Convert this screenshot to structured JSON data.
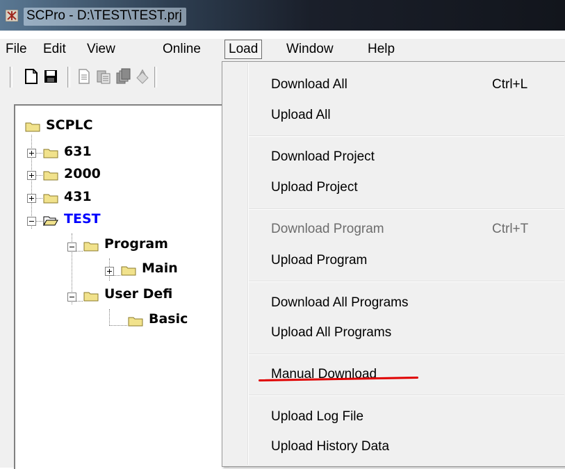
{
  "window": {
    "title": "SCPro - D:\\TEST\\TEST.prj",
    "icon": "app-icon"
  },
  "menubar": {
    "items": [
      "File",
      "Edit",
      "View",
      "Online",
      "Load",
      "Window",
      "Help"
    ],
    "active": "Load"
  },
  "toolbar": {
    "icons": [
      "new-document-icon",
      "save-icon",
      "copy-icon",
      "paste-icon",
      "multi-copy-icon",
      "stamp-icon"
    ]
  },
  "tree": {
    "nodes": [
      {
        "label": "SCPLC"
      },
      {
        "label": "631"
      },
      {
        "label": "2000"
      },
      {
        "label": "431"
      },
      {
        "label": "TEST",
        "selected": true
      },
      {
        "label": "Program"
      },
      {
        "label": "Main"
      },
      {
        "label": "User Defi"
      },
      {
        "label": "Basic"
      }
    ]
  },
  "load_menu": {
    "items": [
      {
        "label": "Download All",
        "shortcut": "Ctrl+L"
      },
      {
        "label": "Upload All"
      },
      {
        "label": "Download Project"
      },
      {
        "label": "Upload Project"
      },
      {
        "label": "Download Program",
        "shortcut": "Ctrl+T",
        "disabled": true
      },
      {
        "label": "Upload Program"
      },
      {
        "label": "Download All Programs"
      },
      {
        "label": "Upload All Programs"
      },
      {
        "label": "Manual Download",
        "highlighted": true
      },
      {
        "label": "Upload Log File"
      },
      {
        "label": "Upload History Data"
      }
    ]
  },
  "colors": {
    "selected_tree_text": "#0000ff",
    "annotation_underline": "#e00000",
    "disabled_text": "#6d6d6d"
  }
}
